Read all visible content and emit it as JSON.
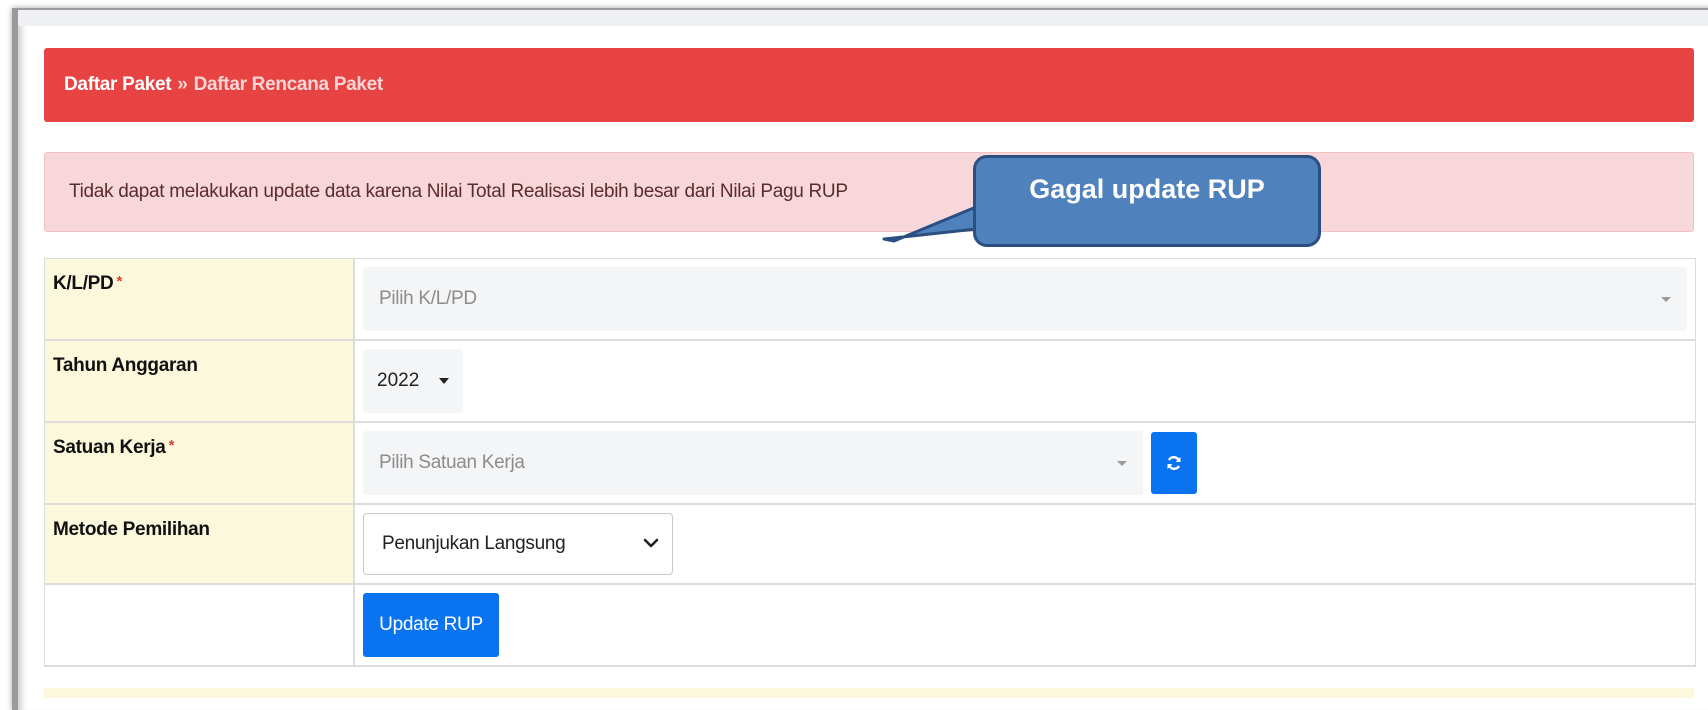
{
  "breadcrumb": {
    "home": "Daftar Paket",
    "separator": "»",
    "current": "Daftar Rencana Paket"
  },
  "alert": {
    "message": "Tidak dapat melakukan update data karena Nilai Total Realisasi lebih besar dari Nilai Pagu RUP"
  },
  "callout": {
    "text": "Gagal update RUP"
  },
  "form": {
    "klpd": {
      "label": "K/L/PD",
      "required_mark": "*",
      "placeholder": "Pilih K/L/PD"
    },
    "tahun": {
      "label": "Tahun Anggaran",
      "value": "2022"
    },
    "satker": {
      "label": "Satuan Kerja",
      "required_mark": "*",
      "placeholder": "Pilih Satuan Kerja",
      "refresh_icon": "refresh-icon"
    },
    "metode": {
      "label": "Metode Pemilihan",
      "value": "Penunjukan Langsung"
    },
    "submit": {
      "label": "Update RUP"
    }
  },
  "colors": {
    "header": "#e84343",
    "alert_bg": "#f8d7da",
    "callout": "#4f81bd",
    "label_bg": "#fbf8dc",
    "primary_button": "#0a74f0"
  }
}
